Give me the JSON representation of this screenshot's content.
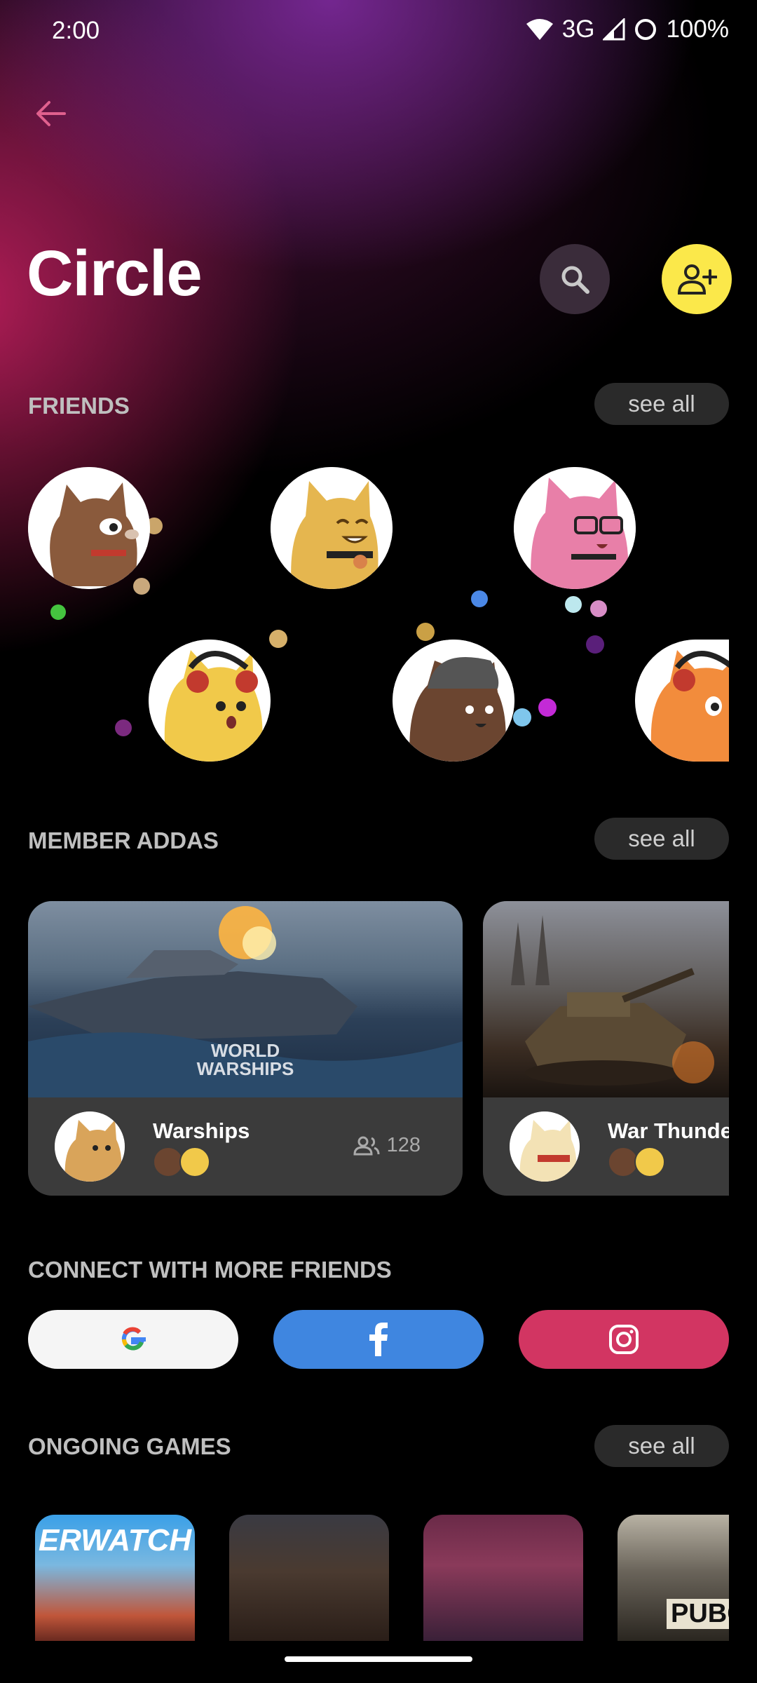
{
  "status_bar": {
    "time": "2:00",
    "network": "3G",
    "battery": "100%",
    "icons": [
      "wifi-icon",
      "signal-icon",
      "battery-icon"
    ]
  },
  "header": {
    "back_icon": "arrow-left-icon",
    "title": "Circle",
    "search_icon": "search-icon",
    "add_friend_icon": "person-add-icon"
  },
  "friends": {
    "title": "FRIENDS",
    "see_all": "see all",
    "avatars": [
      {
        "color": "#8a5a3c"
      },
      {
        "color": "#e5b64f"
      },
      {
        "color": "#e87fa8"
      },
      {
        "color": "#f1c94a"
      },
      {
        "color": "#6b4530"
      },
      {
        "color": "#f28c3c"
      }
    ]
  },
  "member_addas": {
    "title": "MEMBER ADDAS",
    "see_all": "see all",
    "cards": [
      {
        "name": "Warships",
        "member_count": "128",
        "image_text": "WORLD WARSHIPS"
      },
      {
        "name": "War Thunde",
        "member_count": ""
      }
    ]
  },
  "connect": {
    "title": "CONNECT WITH MORE FRIENDS",
    "buttons": [
      {
        "icon": "google-icon",
        "color": "#f5f5f5"
      },
      {
        "icon": "facebook-icon",
        "color": "#3f86e0"
      },
      {
        "icon": "instagram-icon",
        "color": "#d23562"
      }
    ]
  },
  "ongoing_games": {
    "title": "ONGOING GAMES",
    "see_all": "see all",
    "games": [
      {
        "image_text": "ERWATCH"
      },
      {
        "image_text": ""
      },
      {
        "image_text": ""
      },
      {
        "image_text": "PUBG"
      }
    ]
  },
  "colors": {
    "accent_yellow": "#fbe84a",
    "back_arrow": "#e0608e",
    "chip_bg": "#2a2a2a",
    "card_bg": "#3b3b3b"
  }
}
